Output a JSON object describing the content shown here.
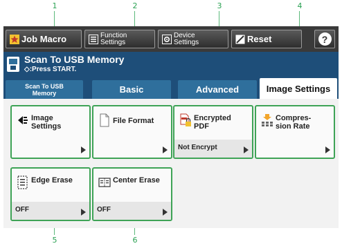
{
  "callouts": [
    "1",
    "2",
    "3",
    "4",
    "5",
    "6"
  ],
  "topbar": {
    "job_macro": "Job Macro",
    "function_settings_line1": "Function",
    "function_settings_line2": "Settings",
    "device_settings_line1": "Device",
    "device_settings_line2": "Settings",
    "reset": "Reset",
    "help": "?"
  },
  "status": {
    "title": "Scan To USB Memory",
    "subtitle": "◇:Press START."
  },
  "tabs": [
    {
      "label_line1": "Scan To USB",
      "label_line2": "Memory"
    },
    {
      "label": "Basic"
    },
    {
      "label": "Advanced"
    },
    {
      "label": "Image Settings"
    }
  ],
  "tiles": [
    {
      "line1": "Image",
      "line2": "Settings",
      "value": "",
      "icon": "image-settings-icon"
    },
    {
      "line1": "File Format",
      "line2": "",
      "value": "",
      "icon": "document-icon"
    },
    {
      "line1": "Encrypted",
      "line2": "PDF",
      "value": "Not Encrypt",
      "icon": "encrypted-pdf-icon"
    },
    {
      "line1": "Compres-",
      "line2": "sion Rate",
      "value": "",
      "icon": "compression-icon"
    },
    {
      "line1": "Edge Erase",
      "line2": "",
      "value": "OFF",
      "icon": "edge-erase-icon"
    },
    {
      "line1": "Center Erase",
      "line2": "",
      "value": "OFF",
      "icon": "center-erase-icon"
    }
  ],
  "colors": {
    "callout_green": "#2aa152",
    "tile_border": "#3ea356",
    "status_blue": "#1e4e79",
    "tab_blue": "#2f6f9c",
    "topbar": "#3a3a3a"
  }
}
